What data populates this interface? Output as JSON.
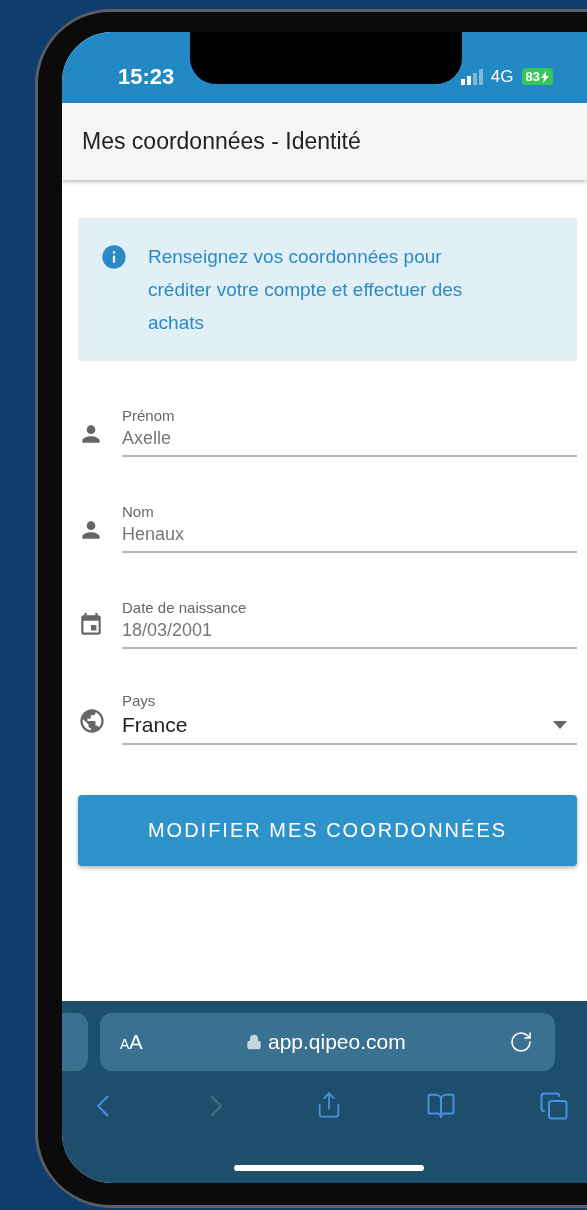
{
  "status_bar": {
    "time": "15:23",
    "network": "4G",
    "battery": "83",
    "charging": true
  },
  "header": {
    "title": "Mes coordonnées - Identité"
  },
  "info": {
    "text": "Renseignez vos coordonnées pour créditer votre compte et effectuer des achats"
  },
  "fields": [
    {
      "kind": "person",
      "label": "Prénom",
      "value": "Axelle"
    },
    {
      "kind": "person",
      "label": "Nom",
      "value": "Henaux"
    },
    {
      "kind": "date",
      "label": "Date de naissance",
      "value": "18/03/2001"
    },
    {
      "kind": "select",
      "label": "Pays",
      "value": "France"
    }
  ],
  "submit_button": "MODIFIER MES COORDONNÉES",
  "browser": {
    "text_size": "AA",
    "url": "app.qipeo.com",
    "secure": true,
    "nav": [
      {
        "kind": "back",
        "disabled": false
      },
      {
        "kind": "forward",
        "disabled": true
      },
      {
        "kind": "share",
        "disabled": false
      },
      {
        "kind": "bookmarks",
        "disabled": false
      },
      {
        "kind": "tabs",
        "disabled": false
      }
    ]
  }
}
